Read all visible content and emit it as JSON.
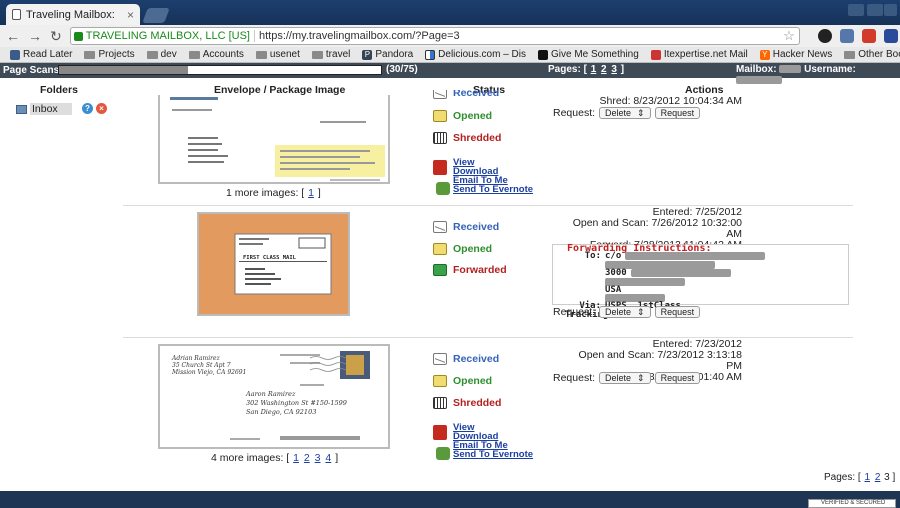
{
  "browser": {
    "tab_title": "Traveling Mailbox:",
    "ev_name": "TRAVELING MAILBOX, LLC [US]",
    "url": "https://my.travelingmailbox.com/?Page=3",
    "bookmarks": [
      "Read Later",
      "Projects",
      "dev",
      "Accounts",
      "usenet",
      "travel",
      "Pandora",
      "Delicious.com – Dis",
      "Give Me Something",
      "Itexpertise.net Mail",
      "Hacker News"
    ],
    "other_bookmarks": "Other Bookmarks"
  },
  "sitebar": {
    "page_scans_label": "Page Scans:",
    "scan_count": "(30/75)",
    "scan_progress": 0.4,
    "pages_label": "Pages: [",
    "pages": [
      "1",
      "2",
      "3"
    ],
    "pages_close": "]",
    "mailbox_label": "Mailbox:",
    "username_label": "Username:"
  },
  "columns": {
    "folders": "Folders",
    "envelope": "Envelope / Package Image",
    "status": "Status",
    "actions": "Actions"
  },
  "sidebar": {
    "inbox_label": "Inbox",
    "help_icon": "?",
    "delete_icon": "×"
  },
  "items": [
    {
      "status": {
        "received": "Received",
        "opened": "Opened",
        "third": "Shredded"
      },
      "links": [
        "View",
        "Download",
        "Email To Me",
        "Send To Evernote"
      ],
      "more_images_prefix": "1 more images: [",
      "more_images_pages": [
        "1"
      ],
      "more_images_suffix": "]",
      "actions": {
        "shred_line": "Shred: 8/23/2012 10:04:34 AM"
      },
      "request_label": "Request:",
      "select_value": "Delete",
      "button_label": "Request"
    },
    {
      "status": {
        "received": "Received",
        "opened": "Opened",
        "third": "Forwarded"
      },
      "actions": {
        "entered": "Entered: 7/25/2012",
        "open_scan": "Open and Scan: 7/26/2012 10:32:00 AM",
        "forward": "Forward: 7/28/2012 11:04:42 AM"
      },
      "forwarding": {
        "title": "Forwarding Instructions:",
        "to_label": "To:",
        "to_value": "c/o",
        "line_3000": "3000",
        "line_usa": "USA",
        "via_label": "Via:",
        "via_value": "USPS, 1stClass",
        "tracking_label": "Tracking:"
      },
      "envelope_label": "FIRST CLASS MAIL",
      "request_label": "Request:",
      "select_value": "Delete",
      "button_label": "Request"
    },
    {
      "status": {
        "received": "Received",
        "opened": "Opened",
        "third": "Shredded"
      },
      "links": [
        "View",
        "Download",
        "Email To Me",
        "Send To Evernote"
      ],
      "more_images_prefix": "4 more images: [",
      "more_images_pages": [
        "1",
        "2",
        "3",
        "4"
      ],
      "more_images_suffix": "]",
      "actions": {
        "entered": "Entered: 7/23/2012",
        "open_scan": "Open and Scan: 7/23/2012 3:13:18 PM",
        "shred_line": "Shred: 7/28/2012 11:01:40 AM"
      },
      "handwriting": {
        "from_name": "Adrian Ramirez",
        "from_line2": "35 Church St Apt 7",
        "from_line3": "Mission Viejo, CA 92691",
        "to_name": "Aaron Ramirez",
        "to_line2": "302 Washington St #150-1599",
        "to_line3": "San Diego, CA 92103"
      },
      "request_label": "Request:",
      "select_value": "Delete",
      "button_label": "Request"
    }
  ],
  "pages_bottom": {
    "label": "Pages: [",
    "pages": [
      "1",
      "2",
      "3"
    ],
    "close": "]"
  },
  "seal_text": "VERIFIED & SECURED"
}
